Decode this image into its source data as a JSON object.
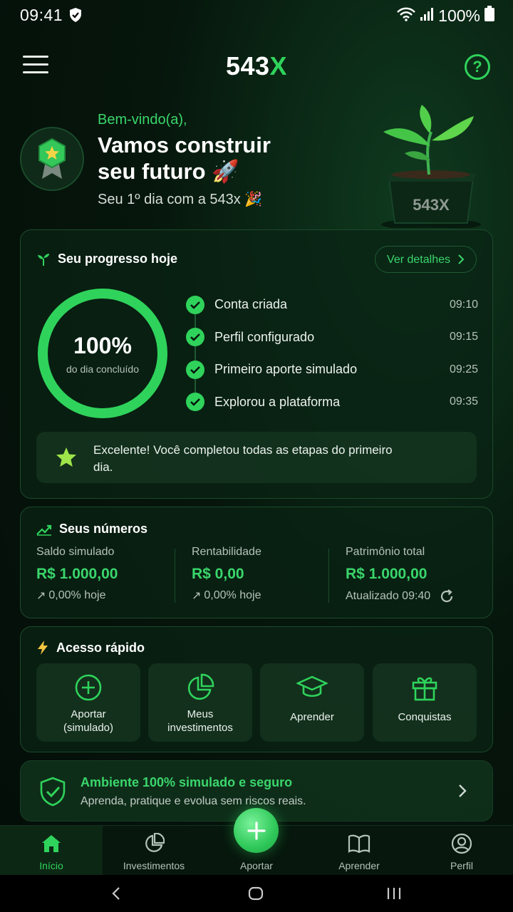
{
  "status": {
    "time": "09:41",
    "battery": "100%"
  },
  "header": {
    "logo_main": "543",
    "logo_x": "X",
    "help": "?"
  },
  "hero": {
    "greeting": "Bem-vindo(a),",
    "title": "Vamos construir seu futuro 🚀",
    "subtitle": "Seu 1º dia com a 543x 🎉",
    "pot_label": "543X"
  },
  "progress": {
    "title": "Seu progresso hoje",
    "details_label": "Ver detalhes",
    "percent_text": "100%",
    "percent_value": 100,
    "ring_label": "do dia concluído",
    "steps": [
      {
        "label": "Conta criada",
        "time": "09:10"
      },
      {
        "label": "Perfil configurado",
        "time": "09:15"
      },
      {
        "label": "Primeiro aporte simulado",
        "time": "09:25"
      },
      {
        "label": "Explorou a plataforma",
        "time": "09:35"
      }
    ],
    "congrats": "Excelente! Você completou todas as etapas do primeiro dia."
  },
  "numbers": {
    "title": "Seus números",
    "cols": [
      {
        "label": "Saldo simulado",
        "value": "R$ 1.000,00",
        "sub": "0,00% hoje"
      },
      {
        "label": "Rentabilidade",
        "value": "R$ 0,00",
        "sub": "0,00% hoje"
      },
      {
        "label": "Patrimônio total",
        "value": "R$ 1.000,00",
        "sub": "Atualizado 09:40"
      }
    ]
  },
  "quick": {
    "title": "Acesso rápido",
    "items": [
      {
        "label": "Aportar\n(simulado)",
        "icon": "plus-circle-icon"
      },
      {
        "label": "Meus\ninvestimentos",
        "icon": "pie-chart-icon"
      },
      {
        "label": "Aprender",
        "icon": "graduation-cap-icon"
      },
      {
        "label": "Conquistas",
        "icon": "gift-icon"
      }
    ]
  },
  "safe": {
    "title": "Ambiente 100% simulado e seguro",
    "subtitle": "Aprenda, pratique e evolua sem riscos reais."
  },
  "nav": {
    "items": [
      {
        "label": "Início",
        "icon": "home-icon",
        "active": true
      },
      {
        "label": "Investimentos",
        "icon": "pie-chart-icon"
      },
      {
        "label": "Aportar",
        "icon": "plus-icon"
      },
      {
        "label": "Aprender",
        "icon": "book-icon"
      },
      {
        "label": "Perfil",
        "icon": "user-icon"
      }
    ]
  },
  "colors": {
    "accent": "#2fd35b",
    "background": "#06160c",
    "card": "#0a2314"
  }
}
